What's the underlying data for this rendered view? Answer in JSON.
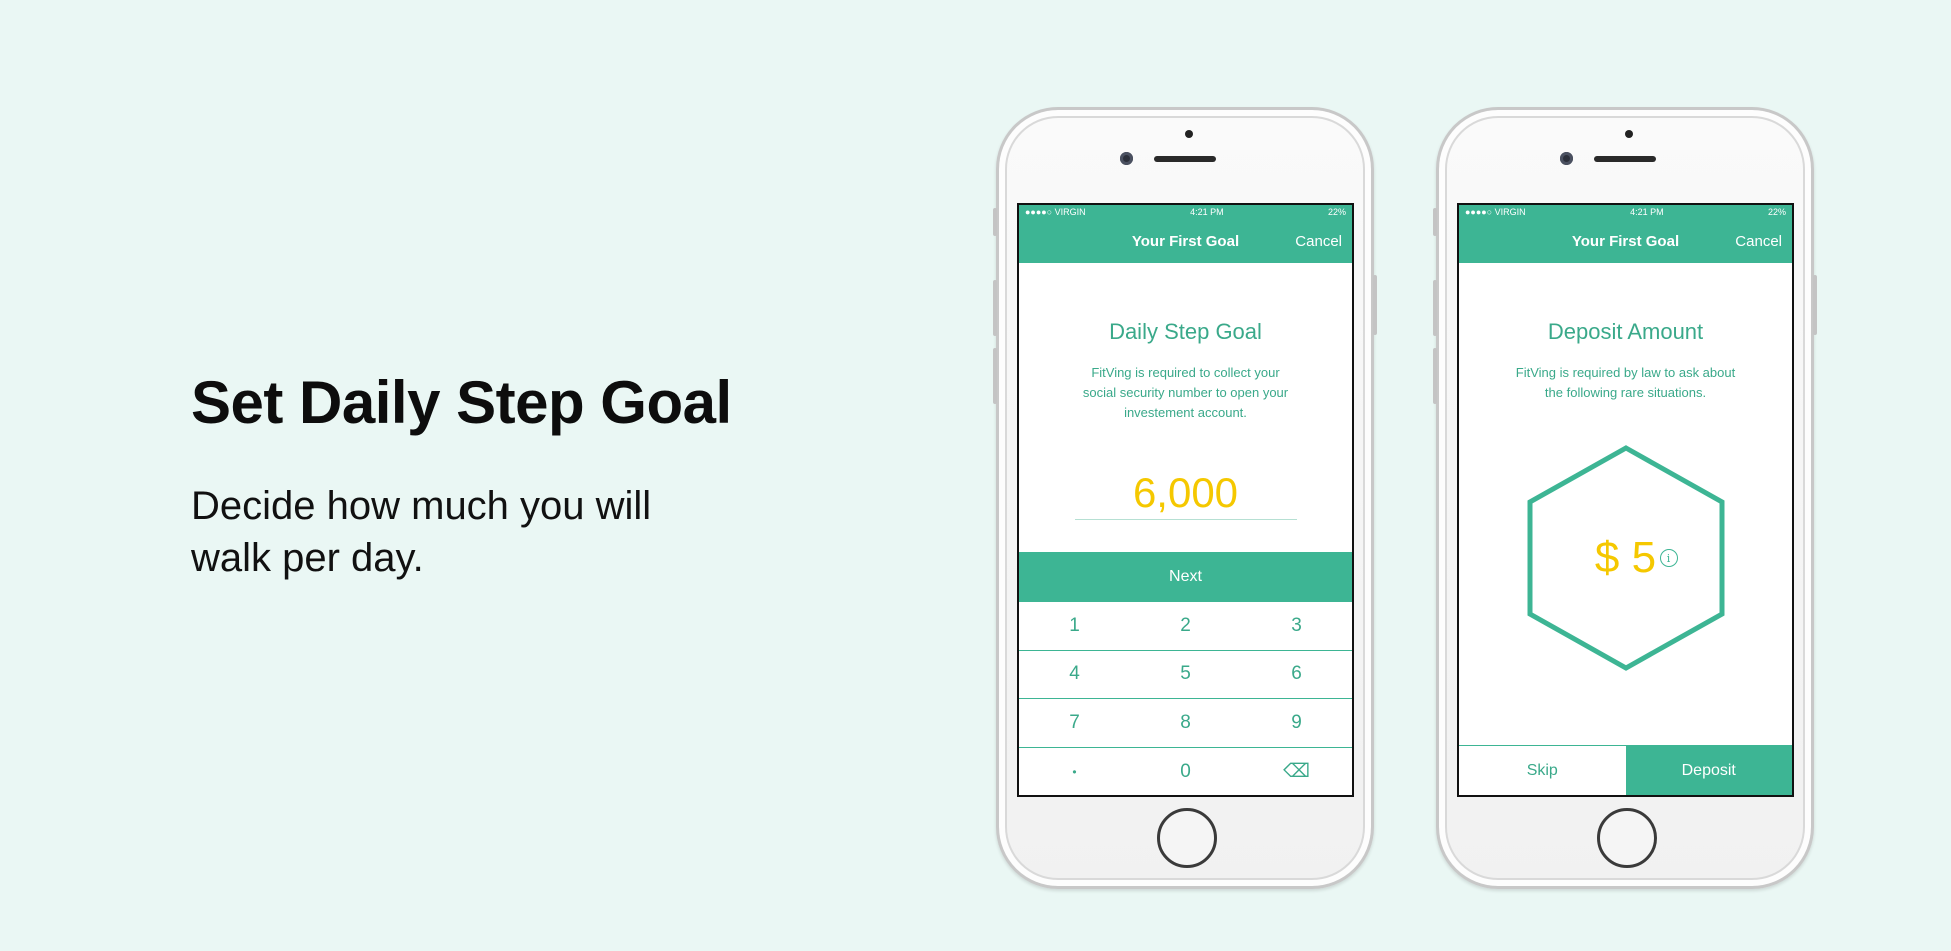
{
  "intro": {
    "title": "Set Daily Step Goal",
    "subtitle": "Decide how much you will walk per day."
  },
  "colors": {
    "accent": "#3db594",
    "highlight": "#f5c800",
    "background": "#eaf7f4"
  },
  "phone1": {
    "status": {
      "carrier": "●●●●○ VIRGIN",
      "time": "4:21 PM",
      "battery": "22%"
    },
    "nav": {
      "title": "Your First Goal",
      "cancel": "Cancel"
    },
    "heading": "Daily Step Goal",
    "description": "FitVing is required to collect your social security number to open your investement account.",
    "goal_value": "6,000",
    "next_label": "Next",
    "keypad": [
      [
        "1",
        "2",
        "3"
      ],
      [
        "4",
        "5",
        "6"
      ],
      [
        "7",
        "8",
        "9"
      ],
      [
        "•",
        "0",
        "⌫"
      ]
    ]
  },
  "phone2": {
    "status": {
      "carrier": "●●●●○ VIRGIN",
      "time": "4:21 PM",
      "battery": "22%"
    },
    "nav": {
      "title": "Your First Goal",
      "cancel": "Cancel"
    },
    "heading": "Deposit Amount",
    "description": "FitVing is required by law to ask about the following rare situations.",
    "amount": "$ 5",
    "info_icon": "i",
    "skip_label": "Skip",
    "deposit_label": "Deposit"
  }
}
